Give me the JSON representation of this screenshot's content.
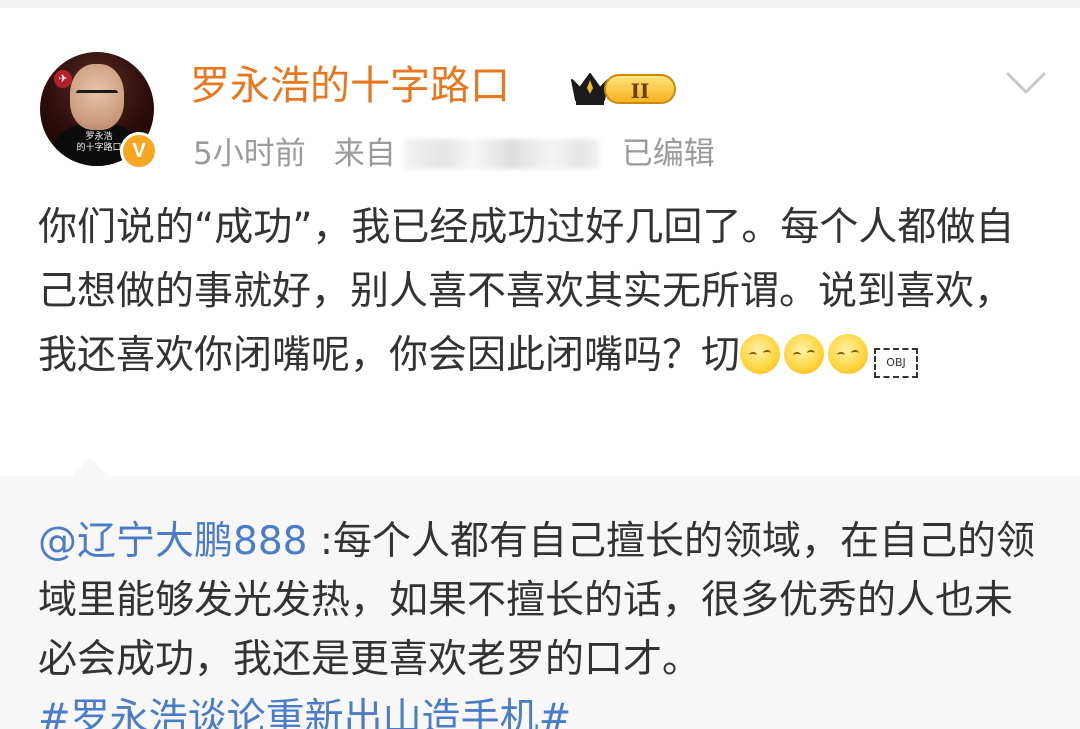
{
  "post": {
    "author": {
      "name": "罗永浩的十字路口",
      "avatar_caption": "罗永浩\n的十字路口",
      "verified_mark": "V",
      "vip_level": "II"
    },
    "meta": {
      "time": "5小时前",
      "source_prefix": "来自",
      "edited": "已编辑"
    },
    "body_text": "你们说的“成功”，我已经成功过好几回了。每个人都做自己想做的事就好，别人喜不喜欢其实无所谓。说到喜欢，我还喜欢你闭嘴呢，你会因此闭嘴吗？切",
    "emoji_count": 3,
    "obj_placeholder": "OBJ"
  },
  "retweet": {
    "mention": "@辽宁大鹏888",
    "text": " :每个人都有自己擅长的领域，在自己的领域里能够发光发热，如果不擅长的话，很多优秀的人也未必会成功，我还是更喜欢老罗的口才。",
    "hashtag": "#罗永浩谈论重新出山造手机#"
  },
  "icons": {
    "expand": "chevron-down-icon",
    "verified": "verified-badge-icon",
    "vip": "vip-crown-icon"
  },
  "colors": {
    "username": "#e8771d",
    "link": "#4a7cc7",
    "meta": "#9b9b9b",
    "body": "#333333",
    "retweet_bg": "#f7f7f7"
  }
}
